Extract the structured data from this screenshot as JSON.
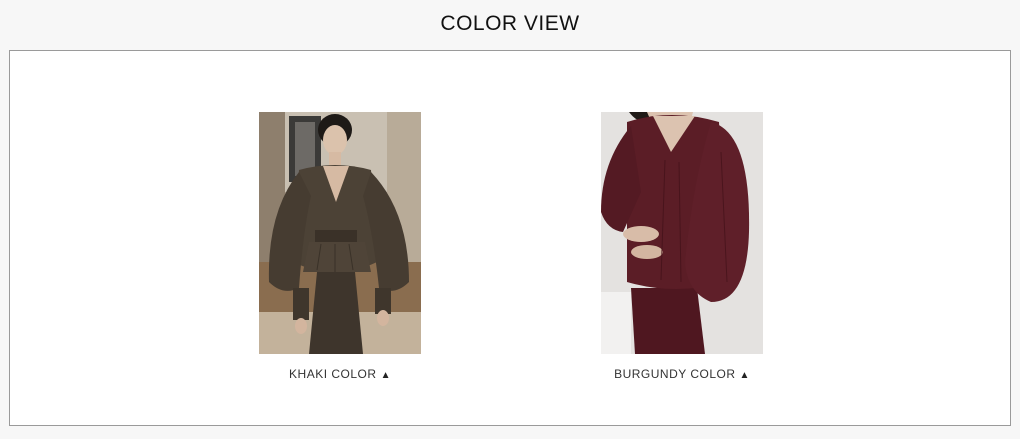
{
  "page": {
    "title": "COLOR VIEW"
  },
  "products": [
    {
      "label": "KHAKI COLOR",
      "arrow_icon": "triangle-up-icon",
      "colors": {
        "dress": "#4a4035",
        "background": "#a59886",
        "skin": "#d9c0aa",
        "hair": "#1d1a17"
      }
    },
    {
      "label": "BURGUNDY COLOR",
      "arrow_icon": "triangle-up-icon",
      "colors": {
        "dress": "#5a1c25",
        "background": "#e6e4e2",
        "skin": "#dcc2b0",
        "hair": "#1d1a17"
      }
    }
  ],
  "colors": {
    "page_bg": "#f7f7f7",
    "frame_bg": "#ffffff",
    "frame_border": "#9a9a9a",
    "text": "#333333"
  }
}
